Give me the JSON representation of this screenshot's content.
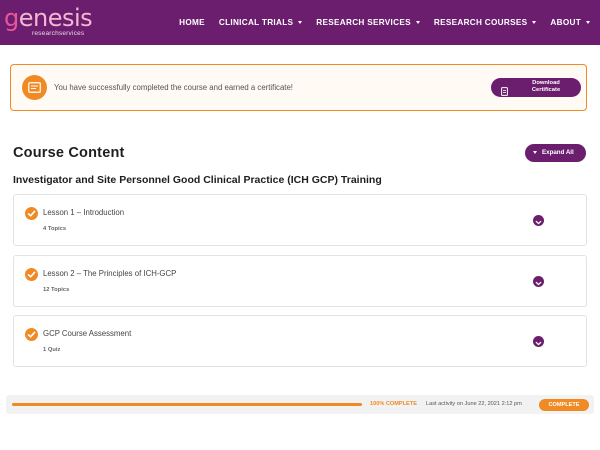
{
  "brand": {
    "logo_first": "g",
    "logo_rest": "enesis",
    "logo_sub": "researchservices",
    "colors": {
      "primary": "#6b1e6e",
      "accent": "#f08a24",
      "logo_pink": "#e8559a"
    }
  },
  "nav": {
    "items": [
      {
        "label": "HOME",
        "has_dropdown": false
      },
      {
        "label": "CLINICAL TRIALS",
        "has_dropdown": true
      },
      {
        "label": "RESEARCH SERVICES",
        "has_dropdown": true
      },
      {
        "label": "RESEARCH COURSES",
        "has_dropdown": true
      },
      {
        "label": "ABOUT",
        "has_dropdown": true
      }
    ]
  },
  "banner": {
    "icon": "certificate-icon",
    "message": "You have successfully completed the course and earned a certificate!",
    "button": {
      "line1": "Download",
      "line2": "Certificate",
      "icon": "document-icon"
    }
  },
  "content": {
    "section_title": "Course Content",
    "expand_label": "Expand All",
    "course_title": "Investigator and Site Personnel Good Clinical Practice (ICH GCP) Training",
    "lessons": [
      {
        "name": "Lesson 1 – Introduction",
        "meta": "4 Topics",
        "completed": true
      },
      {
        "name": "Lesson 2 – The Principles of ICH-GCP",
        "meta": "12 Topics",
        "completed": true
      },
      {
        "name": "GCP Course Assessment",
        "meta": "1 Quiz",
        "completed": true
      }
    ]
  },
  "progress": {
    "percent": 100,
    "percent_label": "100% COMPLETE",
    "activity": "Last activity on June 22, 2021 2:12 pm",
    "status": "COMPLETE"
  }
}
